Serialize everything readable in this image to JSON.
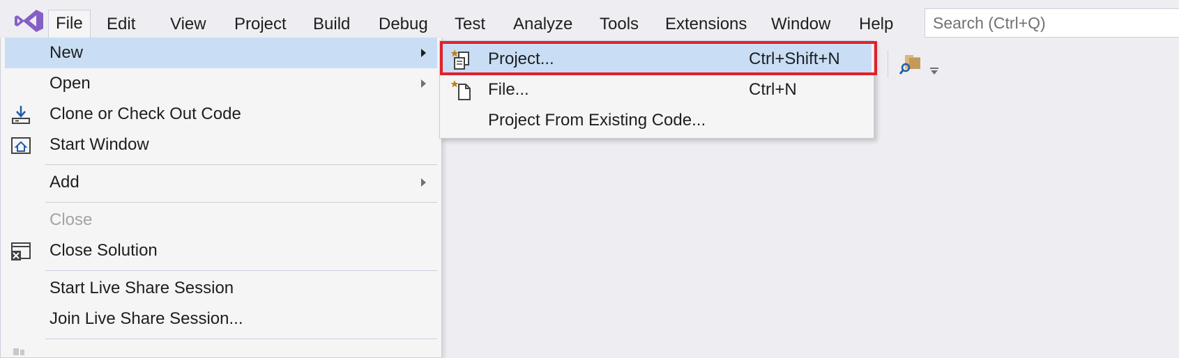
{
  "menubar": {
    "items": [
      "File",
      "Edit",
      "View",
      "Project",
      "Build",
      "Debug",
      "Test",
      "Analyze",
      "Tools",
      "Extensions",
      "Window",
      "Help"
    ],
    "active": "File"
  },
  "search": {
    "placeholder": "Search (Ctrl+Q)"
  },
  "file_menu": {
    "new": "New",
    "open": "Open",
    "clone": "Clone or Check Out Code",
    "start_window": "Start Window",
    "add": "Add",
    "close": "Close",
    "close_solution": "Close Solution",
    "start_live_share": "Start Live Share Session",
    "join_live_share": "Join Live Share Session..."
  },
  "new_submenu": {
    "project": {
      "label": "Project...",
      "shortcut": "Ctrl+Shift+N"
    },
    "file": {
      "label": "File...",
      "shortcut": "Ctrl+N"
    },
    "existing": {
      "label": "Project From Existing Code..."
    }
  },
  "colors": {
    "highlight": "#c9def5",
    "callout": "#e3202b",
    "logo": "#865fc5"
  }
}
